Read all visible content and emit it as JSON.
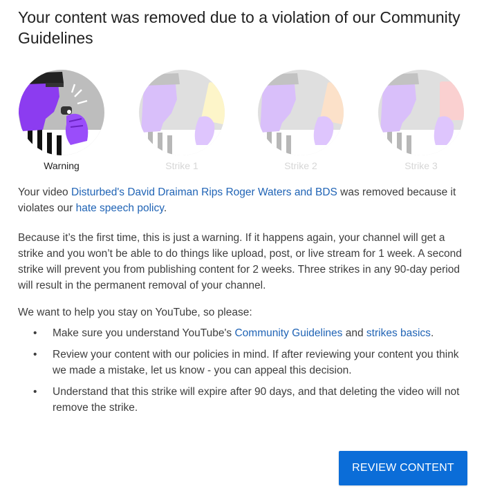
{
  "dialog": {
    "title": "Your content was removed due to a violation of our Community Guidelines"
  },
  "stages": [
    {
      "label": "Warning",
      "state": "active",
      "illustration": "referee-whistle"
    },
    {
      "label": "Strike 1",
      "state": "inactive",
      "illustration": "referee-yellow-card"
    },
    {
      "label": "Strike 2",
      "state": "inactive",
      "illustration": "referee-orange-card"
    },
    {
      "label": "Strike 3",
      "state": "inactive",
      "illustration": "referee-red-card"
    }
  ],
  "notice": {
    "p1_prefix": "Your video ",
    "video_link": "Disturbed's David Draiman Rips Roger Waters and BDS",
    "p1_middle": " was removed because it violates our ",
    "policy_link": "hate speech policy",
    "p1_suffix": ".",
    "p2": "Because it’s the first time, this is just a warning. If it happens again, your channel will get a strike and you won’t be able to do things like upload, post, or live stream for 1 week. A second strike will prevent you from publishing content for 2 weeks. Three strikes in any 90-day period will result in the permanent removal of your channel.",
    "p3": "We want to help you stay on YouTube, so please:"
  },
  "tips": {
    "bullet": "•",
    "t1_prefix": "Make sure you understand YouTube's ",
    "t1_link1": "Community Guidelines",
    "t1_middle": " and ",
    "t1_link2": "strikes basics",
    "t1_suffix": ".",
    "t2_prefix": "Review your content with our policies in mind. If after reviewing your content you think we made a mistake, ",
    "t2_link": "let us know",
    "t2_suffix": " - you can appeal this decision.",
    "t3": "Understand that this strike will expire after 90 days, and that deleting the video will not remove the strike."
  },
  "actions": {
    "review_label": "REVIEW CONTENT"
  },
  "colors": {
    "accent": "#0b6dd8",
    "link": "#1f63b5",
    "purple": "#8c3cf0",
    "yellow_card": "#fbe25a",
    "orange_card": "#f8a35a",
    "red_card": "#f07070"
  }
}
